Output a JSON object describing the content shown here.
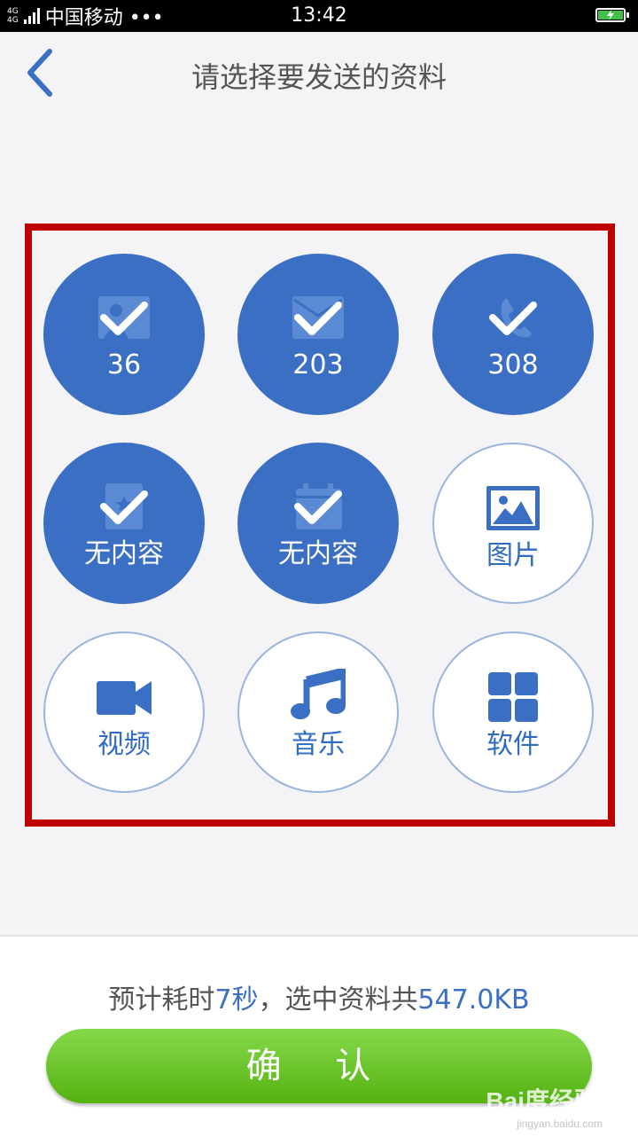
{
  "status_bar": {
    "network_labels": [
      "4G",
      "4G"
    ],
    "carrier": "中国移动 •••",
    "time": "13:42"
  },
  "header": {
    "title": "请选择要发送的资料"
  },
  "tiles": [
    {
      "label": "36",
      "selected": true,
      "icon": "contacts-icon"
    },
    {
      "label": "203",
      "selected": true,
      "icon": "messages-icon"
    },
    {
      "label": "308",
      "selected": true,
      "icon": "call-log-icon"
    },
    {
      "label": "无内容",
      "selected": true,
      "icon": "bookmark-icon"
    },
    {
      "label": "无内容",
      "selected": true,
      "icon": "calendar-icon"
    },
    {
      "label": "图片",
      "selected": false,
      "icon": "image-icon"
    },
    {
      "label": "视频",
      "selected": false,
      "icon": "video-icon"
    },
    {
      "label": "音乐",
      "selected": false,
      "icon": "music-icon"
    },
    {
      "label": "软件",
      "selected": false,
      "icon": "apps-icon"
    }
  ],
  "footer": {
    "estimate_prefix": "预计耗时",
    "estimate_time": "7秒",
    "estimate_middle": "，选中资料共",
    "estimate_size": "547.0KB",
    "confirm_label": "确 认"
  },
  "watermark": {
    "brand": "Bai度经验",
    "url": "jingyan.baidu.com"
  },
  "colors": {
    "selected_fill": "#3a6fc4",
    "unselected_border": "#9bb4df",
    "highlight_frame": "#c00000",
    "confirm_green": "#6cc62e"
  }
}
